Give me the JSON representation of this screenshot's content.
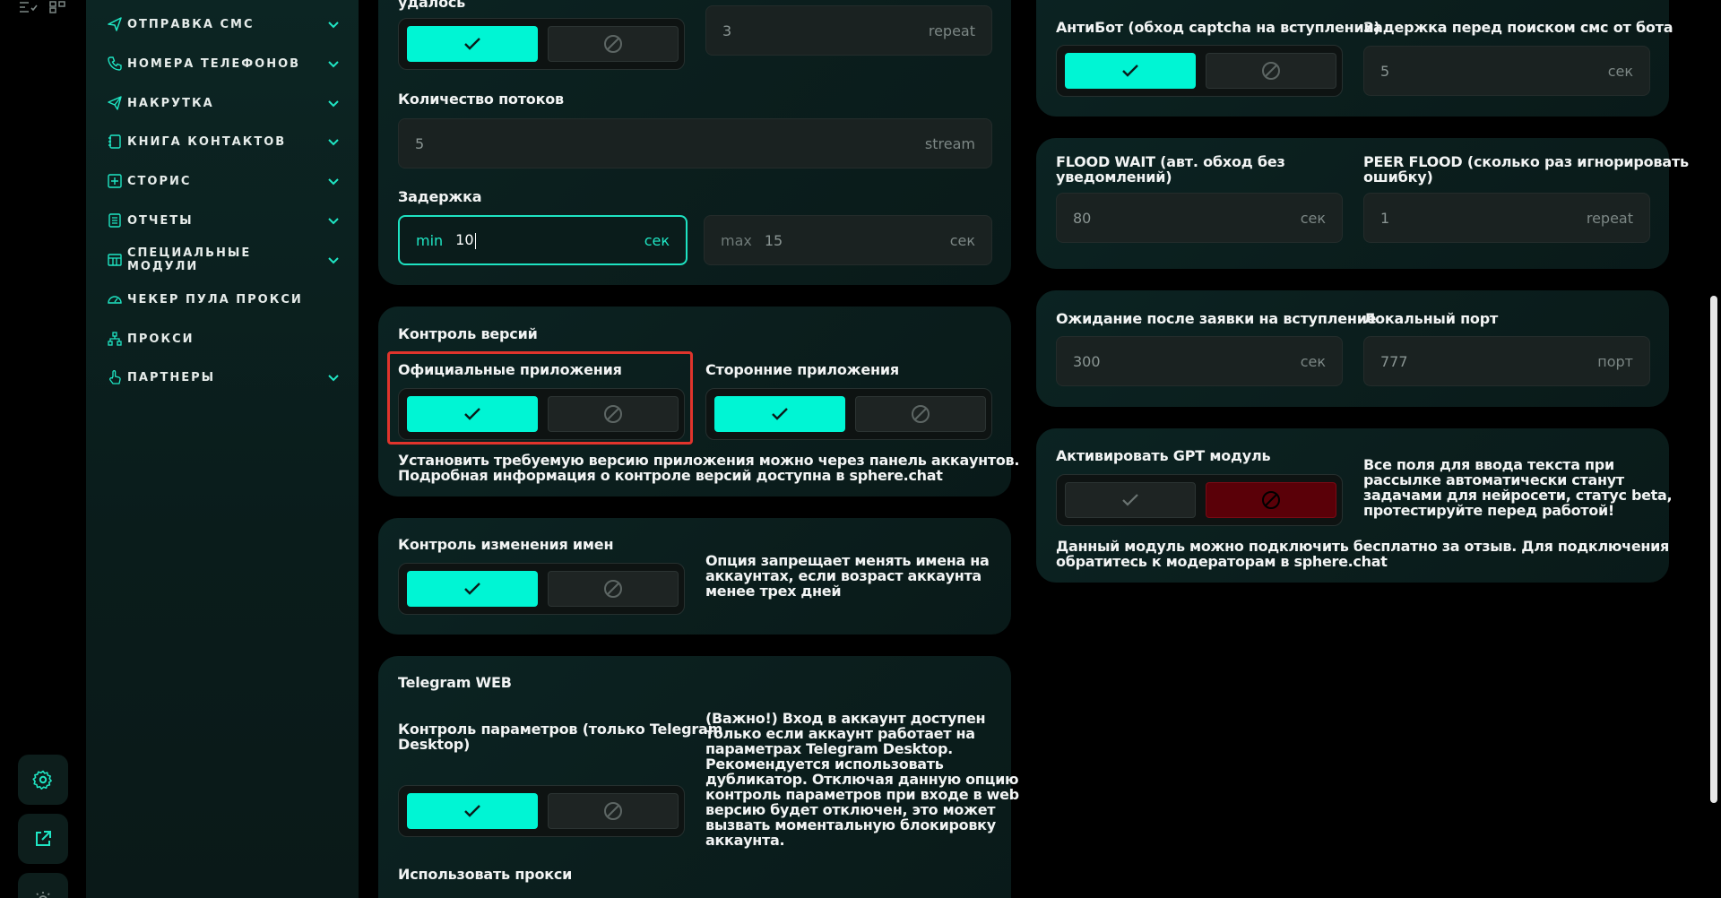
{
  "nav": {
    "items": [
      {
        "label": "ОТПРАВКА СМС",
        "icon": "send-icon",
        "chevron": true
      },
      {
        "label": "НОМЕРА ТЕЛЕФОНОВ",
        "icon": "phone-icon",
        "chevron": true
      },
      {
        "label": "НАКРУТКА",
        "icon": "paper-plane-icon",
        "chevron": true
      },
      {
        "label": "КНИГА КОНТАКТОВ",
        "icon": "book-icon",
        "chevron": true
      },
      {
        "label": "СТОРИС",
        "icon": "plus-square-icon",
        "chevron": true
      },
      {
        "label": "ОТЧЕТЫ",
        "icon": "report-icon",
        "chevron": true
      },
      {
        "label": "СПЕЦИАЛЬНЫЕ МОДУЛИ",
        "icon": "modules-icon",
        "chevron": true
      },
      {
        "label": "ЧЕКЕР ПУЛА ПРОКСИ",
        "icon": "gauge-icon",
        "chevron": false
      },
      {
        "label": "ПРОКСИ",
        "icon": "network-icon",
        "chevron": false
      },
      {
        "label": "ПАРТНЕРЫ",
        "icon": "hand-icon",
        "chevron": true
      }
    ]
  },
  "left": {
    "top_label": "удалось",
    "retry_field": {
      "value": "3",
      "unit": "repeat"
    },
    "threads": {
      "label": "Количество потоков",
      "value": "5",
      "unit": "stream"
    },
    "delay": {
      "label": "Задержка",
      "min_prefix": "min",
      "min_value": "10",
      "min_unit": "сек",
      "max_prefix": "max",
      "max_value": "15",
      "max_unit": "сек"
    },
    "versions": {
      "title": "Контроль версий",
      "official_label": "Официальные приложения",
      "third_party_label": "Сторонние приложения",
      "note_line1": "Установить требуемую версию приложения можно через панель аккаунтов.",
      "note_line2": "Подробная информация о контроле версий доступна в sphere.chat"
    },
    "names": {
      "title": "Контроль изменения имен",
      "note_line1": "Опция запрещает менять имена на",
      "note_line2": "аккаунтах, если возраст аккаунта",
      "note_line3": "менее трех дней"
    },
    "web": {
      "title": "Telegram WEB",
      "params_label_line1": "Контроль параметров (только Telegram",
      "params_label_line2": "Desktop)",
      "note_lines": [
        "(Важно!) Вход в аккаунт доступен",
        "только если аккаунт работает на",
        "параметрах Telegram Desktop.",
        "Рекомендуется использовать",
        "дубликатор. Отключая данную опцию",
        "контроль параметров при входе в web",
        "версию будет отключен, это может",
        "вызвать моментальную блокировку",
        "аккаунта."
      ],
      "proxy_label": "Использовать прокси"
    }
  },
  "right": {
    "antibot": {
      "label": "АнтиБот (обход captcha на вступлении)"
    },
    "sms_delay": {
      "label": "Задержка перед поиском смс от бота",
      "value": "5",
      "unit": "сек"
    },
    "flood": {
      "label_line1": "FLOOD WAIT (авт. обход без",
      "label_line2": "уведомлений)",
      "value": "80",
      "unit": "сек"
    },
    "peer": {
      "label_line1": "PEER FLOOD (сколько раз игнорировать",
      "label_line2": "ошибку)",
      "value": "1",
      "unit": "repeat"
    },
    "wait": {
      "label": "Ожидание после заявки на вступление",
      "value": "300",
      "unit": "сек"
    },
    "port": {
      "label": "Локальный порт",
      "value": "777",
      "unit": "порт"
    },
    "gpt": {
      "label": "Активировать GPT модуль",
      "side_note": [
        "Все поля для ввода текста при",
        "рассылке автоматически станут",
        "задачами для нейросети, статус beta,",
        "протестируйте перед работой!"
      ],
      "note_line1": "Данный модуль можно подключить бесплатно за отзыв. Для подключения",
      "note_line2": "обратитесь к модераторам в sphere.chat"
    }
  },
  "colors": {
    "accent": "#00F5D4",
    "danger": "#5A0008",
    "highlight": "#E0342C"
  }
}
